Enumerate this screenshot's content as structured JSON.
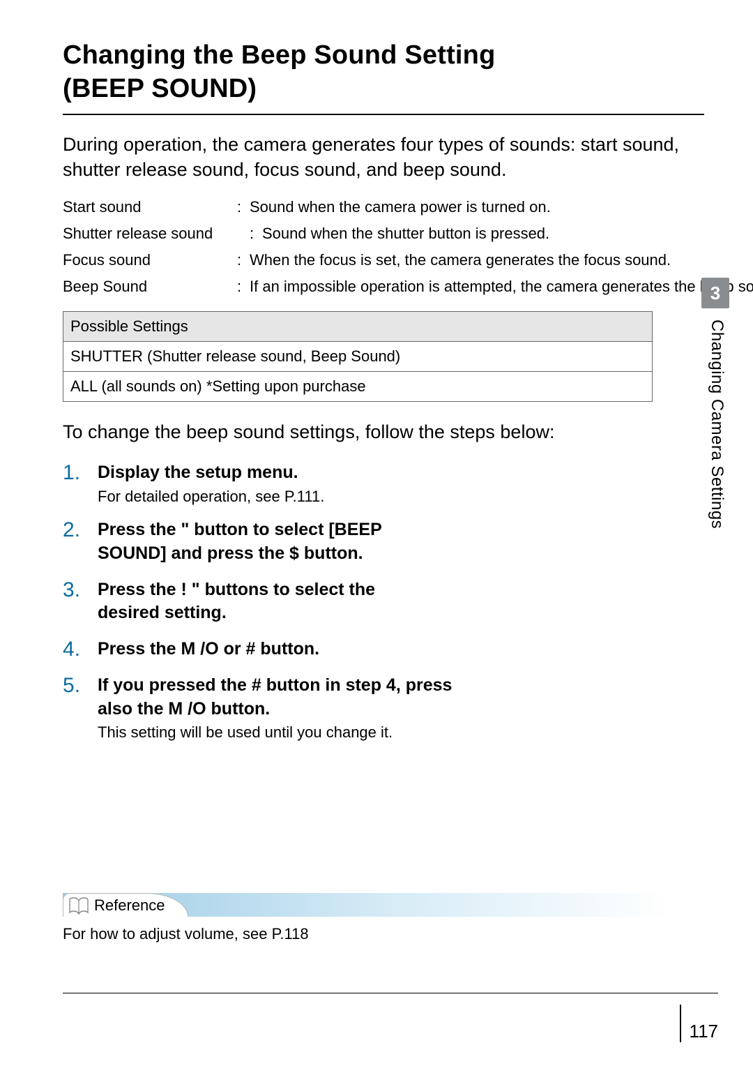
{
  "title_line1": "Changing the Beep Sound Setting",
  "title_line2": "(BEEP SOUND)",
  "intro": "During operation, the camera generates four types of sounds: start sound, shutter release sound, focus sound, and beep sound.",
  "sounds": [
    {
      "label": "Start sound",
      "desc": "Sound when the camera power is turned on."
    },
    {
      "label": "Shutter release sound",
      "desc": "Sound when the shutter button is pressed."
    },
    {
      "label": "Focus sound",
      "desc": "When the focus is set, the camera generates the focus sound."
    },
    {
      "label": "Beep Sound",
      "desc": "If an impossible operation is attempted, the camera generates the beep so"
    }
  ],
  "settings_header": "Possible Settings",
  "settings_rows": [
    "SHUTTER (Shutter release sound, Beep Sound)",
    "ALL (all sounds on)  *Setting upon purchase"
  ],
  "mid_text": "To change the beep sound settings, follow the steps below:",
  "steps": [
    {
      "bold": "Display the setup menu.",
      "sub": "For detailed operation, see P.111."
    },
    {
      "bold": "Press the \"   button to select [BEEP SOUND] and press the $ button.",
      "sub": ""
    },
    {
      "bold": "Press the !  \"   buttons to select the desired setting.",
      "sub": ""
    },
    {
      "bold": "Press the M       /O    or #  button.",
      "sub": ""
    },
    {
      "bold": "If you pressed the #  button in step 4, press also the M       /O    button.",
      "sub": "This setting will be used until you change it."
    }
  ],
  "side_tab": "3",
  "side_text": "Changing Camera Settings",
  "reference_label": "Reference",
  "reference_body": "For how to adjust volume, see P.118",
  "page_number": "117"
}
